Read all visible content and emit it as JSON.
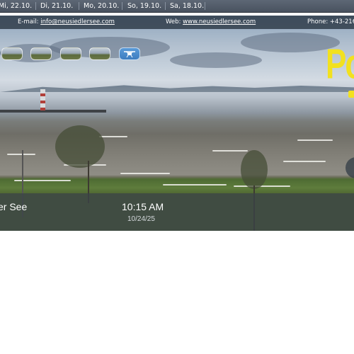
{
  "date_tabs": [
    "Mi, 22.10.",
    "Di, 21.10.",
    "Mo, 20.10.",
    "So, 19.10.",
    "Sa, 18.10."
  ],
  "info_bar": {
    "email_label": "E-mail:",
    "email": "info@neusiedlersee.com",
    "web_label": "Web:",
    "web": "www.neusiedlersee.com",
    "phone": "Phone: +43-216"
  },
  "thumbnails": [
    {
      "icon": "lake-view-thumbnail"
    },
    {
      "icon": "shore-view-thumbnail"
    },
    {
      "icon": "harbor-view-thumbnail"
    },
    {
      "icon": "meadow-view-thumbnail"
    },
    {
      "icon": "drone-icon"
    }
  ],
  "logo": {
    "text": "Po"
  },
  "overlay": {
    "location": "er See",
    "time": "10:15 AM",
    "date": "10/24/25"
  },
  "colors": {
    "bar": "#49525f",
    "logo": "#f2e11f",
    "drone_button": "#3d7dc0"
  }
}
